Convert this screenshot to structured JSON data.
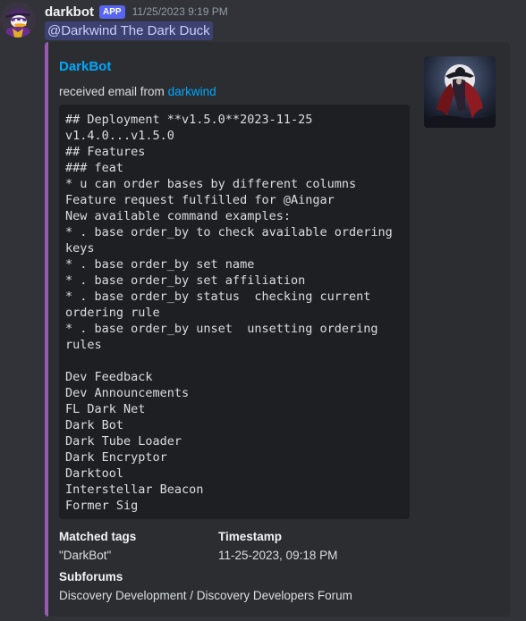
{
  "message": {
    "username": "darkbot",
    "badge": "APP",
    "timestamp": "11/25/2023 9:19 PM",
    "mention": "@Darkwind The Dark Duck"
  },
  "embed": {
    "title": "DarkBot",
    "accent_color": "#9b59b6",
    "description_prefix": "received email from",
    "description_link": "darkwind",
    "code_lines": [
      "## Deployment **v1.5.0**2023-11-25",
      "v1.4.0...v1.5.0",
      "## Features",
      "### feat",
      "* u can order bases by different columns",
      "Feature request fulfilled for @Aingar",
      "New available command examples:",
      "* . base order_by to check available ordering",
      "keys",
      "* . base order_by set name",
      "* . base order_by set affiliation",
      "* . base order_by status  checking current",
      "ordering rule",
      "* . base order_by unset  unsetting ordering",
      "rules",
      "",
      "Dev Feedback",
      "Dev Announcements",
      "FL Dark Net",
      "Dark Bot",
      "Dark Tube Loader",
      "Dark Encryptor",
      "Darktool",
      "Interstellar Beacon",
      "Former Sig"
    ],
    "fields": {
      "matched_tags": {
        "name": "Matched tags",
        "value": "\"DarkBot\""
      },
      "timestamp": {
        "name": "Timestamp",
        "value": "11-25-2023, 09:18 PM"
      },
      "subforums": {
        "name": "Subforums",
        "value": "Discovery Development / Discovery Developers Forum"
      }
    }
  },
  "icons": {
    "avatar": "darkwing-duck-avatar-icon",
    "thumbnail": "caped-figure-moon-thumbnail-icon"
  },
  "colors": {
    "background": "#313338",
    "embed_background": "#2b2d31",
    "code_background": "#1e1f22",
    "link": "#00a8fc",
    "badge": "#5865f2"
  }
}
